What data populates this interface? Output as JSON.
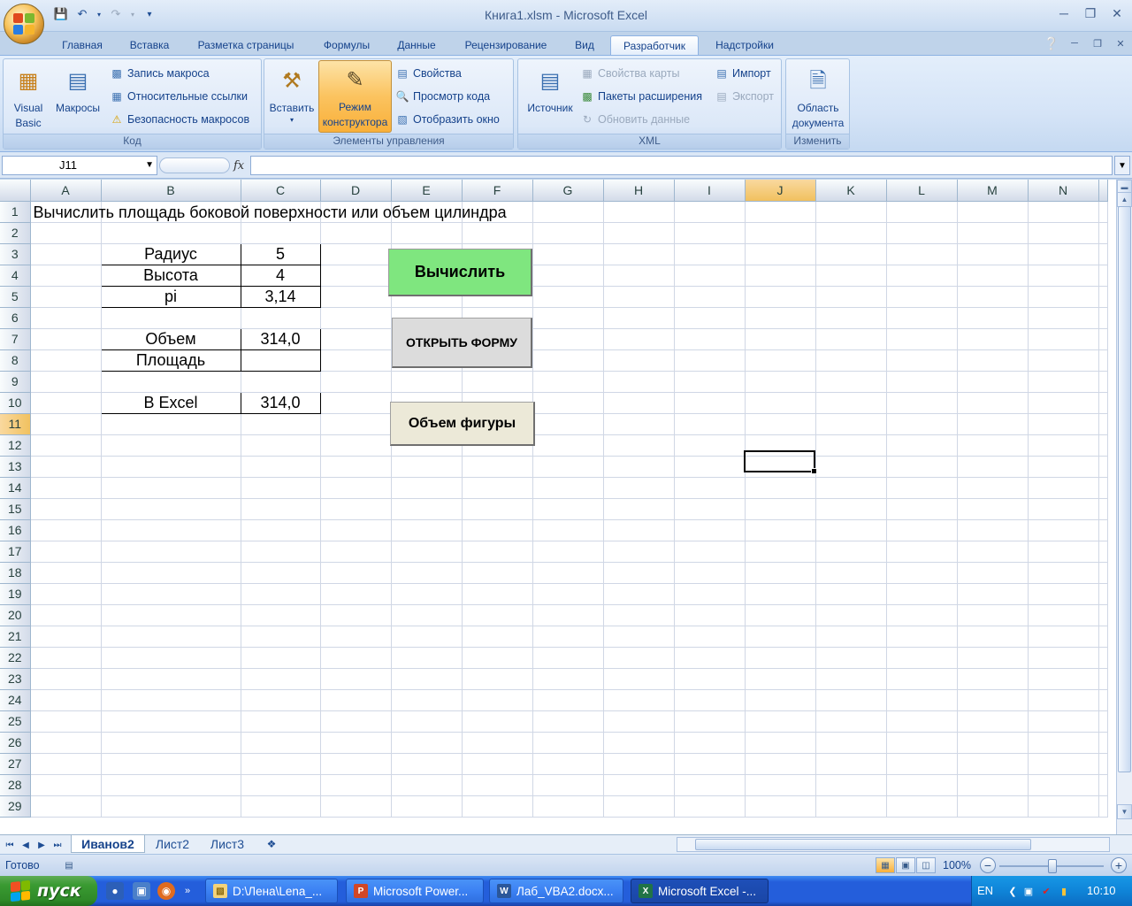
{
  "window": {
    "title": "Книга1.xlsm - Microsoft Excel"
  },
  "ribbon_tabs": [
    "Главная",
    "Вставка",
    "Разметка страницы",
    "Формулы",
    "Данные",
    "Рецензирование",
    "Вид",
    "Разработчик",
    "Надстройки"
  ],
  "active_tab": "Разработчик",
  "groups": {
    "code": {
      "label": "Код",
      "visual_basic": [
        "Visual",
        "Basic"
      ],
      "macros": "Макросы",
      "record_macro": "Запись макроса",
      "relative_refs": "Относительные ссылки",
      "macro_security": "Безопасность макросов"
    },
    "controls": {
      "label": "Элементы управления",
      "insert": "Вставить",
      "design_mode": [
        "Режим",
        "конструктора"
      ],
      "properties": "Свойства",
      "view_code": "Просмотр кода",
      "run_dialog": "Отобразить окно"
    },
    "xml": {
      "label": "XML",
      "source": "Источник",
      "map_properties": "Свойства карты",
      "expansion_packs": "Пакеты расширения",
      "refresh_data": "Обновить данные",
      "import": "Импорт",
      "export": "Экспорт"
    },
    "modify": {
      "label": "Изменить",
      "doc_panel": [
        "Область",
        "документа"
      ]
    }
  },
  "formula_bar": {
    "name_box": "J11",
    "fx": "fx",
    "formula": ""
  },
  "columns": [
    "A",
    "B",
    "C",
    "D",
    "E",
    "F",
    "G",
    "H",
    "I",
    "J",
    "K",
    "L",
    "M",
    "N"
  ],
  "selected_column": "J",
  "selected_row": 11,
  "cells": {
    "A1": "Вычислить площадь боковой поверхности или объем цилиндра",
    "B3": "Радиус",
    "C3": "5",
    "B4": "Высота",
    "C4": "4",
    "B5": "pi",
    "C5": "3,14",
    "B7": "Объем",
    "C7": "314,0",
    "B8": "Площадь",
    "C8": "",
    "B10": "В Excel",
    "C10": "314,0"
  },
  "buttons": {
    "calculate": "Вычислить",
    "open_form": "ОТКРЫТЬ ФОРМУ",
    "shape_volume": "Объем фигуры"
  },
  "sheets": [
    "Иванов2",
    "Лист2",
    "Лист3"
  ],
  "active_sheet": "Иванов2",
  "status": {
    "ready": "Готово",
    "zoom": "100%"
  },
  "colors": {
    "calculate_button": "#7fe67f",
    "gray_button": "#dcdcdc",
    "beige_button": "#ece9d8",
    "selected_header": "#f6c86a"
  },
  "taskbar": {
    "start": "пуск",
    "tasks": [
      "D:\\Лена\\Lena_...",
      "Microsoft Power...",
      "Лаб_VBA2.docx...",
      "Microsoft Excel -..."
    ],
    "lang": "EN",
    "clock": "10:10"
  }
}
